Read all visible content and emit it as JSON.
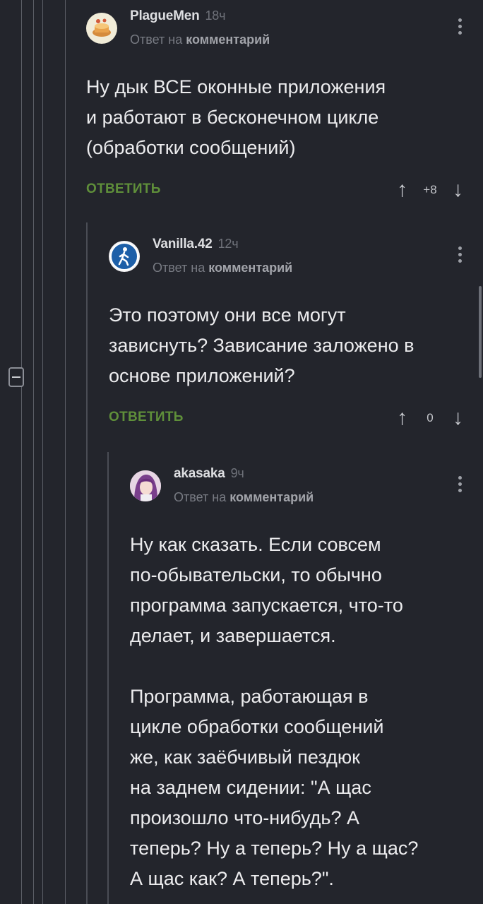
{
  "comments": [
    {
      "author": "PlagueMen",
      "time": "18ч",
      "reply_prefix": "Ответ на",
      "reply_link": "комментарий",
      "text": [
        "Ну дык ВСЕ оконные приложения",
        "и работают в бесконечном цикле",
        "(обработки сообщений)"
      ],
      "reply_label": "ОТВЕТИТЬ",
      "votes": "+8",
      "avatar": "pie-avatar"
    },
    {
      "author": "Vanilla.42",
      "time": "12ч",
      "reply_prefix": "Ответ на",
      "reply_link": "комментарий",
      "text": [
        "Это поэтому они все могут",
        "зависнуть? Зависание заложено в",
        "основе приложений?"
      ],
      "reply_label": "ОТВЕТИТЬ",
      "votes": "0",
      "avatar": "walking-person-avatar"
    },
    {
      "author": "akasaka",
      "time": "9ч",
      "reply_prefix": "Ответ на",
      "reply_link": "комментарий",
      "text": [
        "Ну как сказать. Если совсем",
        "по-обывательски, то обычно",
        "программа запускается, что-то",
        "делает, и завершается.",
        "",
        "Программа, работающая в",
        "цикле обработки сообщений",
        "же, как заёбчивый пездюк",
        "на заднем сидении: \"А щас",
        "произошло что-нибудь? А",
        "теперь? Ну а теперь? Ну а щас?",
        "А щас как? А теперь?\"."
      ],
      "avatar": "anime-girl-avatar"
    }
  ],
  "colors": {
    "background": "#23252c",
    "reply_button": "#5f8f3a",
    "meta": "#787b83"
  }
}
